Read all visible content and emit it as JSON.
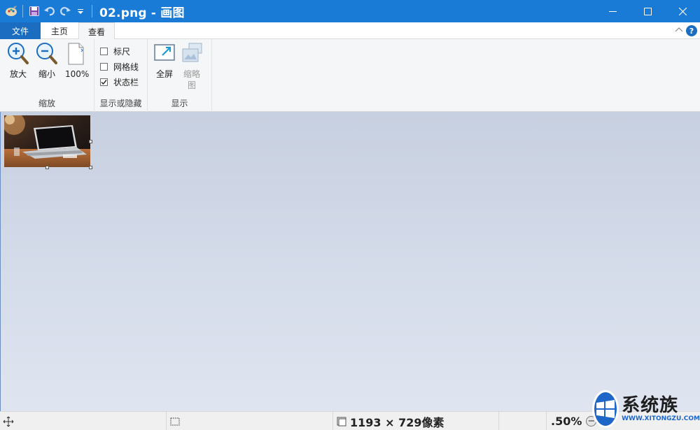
{
  "window": {
    "title": "02.png - 画图",
    "accent": "#1a7bd6"
  },
  "qat": {
    "icons": [
      "paint-app-icon",
      "save-icon",
      "undo-icon",
      "redo-icon",
      "customize-dropdown-icon"
    ]
  },
  "tabs": {
    "file": "文件",
    "home": "主页",
    "view": "查看"
  },
  "ribbon": {
    "zoom_group": {
      "label": "缩放",
      "zoom_in": "放大",
      "zoom_out": "缩小",
      "hundred": "100%"
    },
    "show_hide_group": {
      "label": "显示或隐藏",
      "items": [
        {
          "label": "标尺",
          "checked": false
        },
        {
          "label": "网格线",
          "checked": false
        },
        {
          "label": "状态栏",
          "checked": true
        }
      ]
    },
    "display_group": {
      "label": "显示",
      "fullscreen": "全屏",
      "thumbnail": "缩略图"
    }
  },
  "statusbar": {
    "dimensions": "1193 × 729像素",
    "zoom": ".50%",
    "zoom_minus": "−"
  },
  "watermark": {
    "brand": "系统族",
    "url": "WWW.XITONGZU.COM"
  }
}
